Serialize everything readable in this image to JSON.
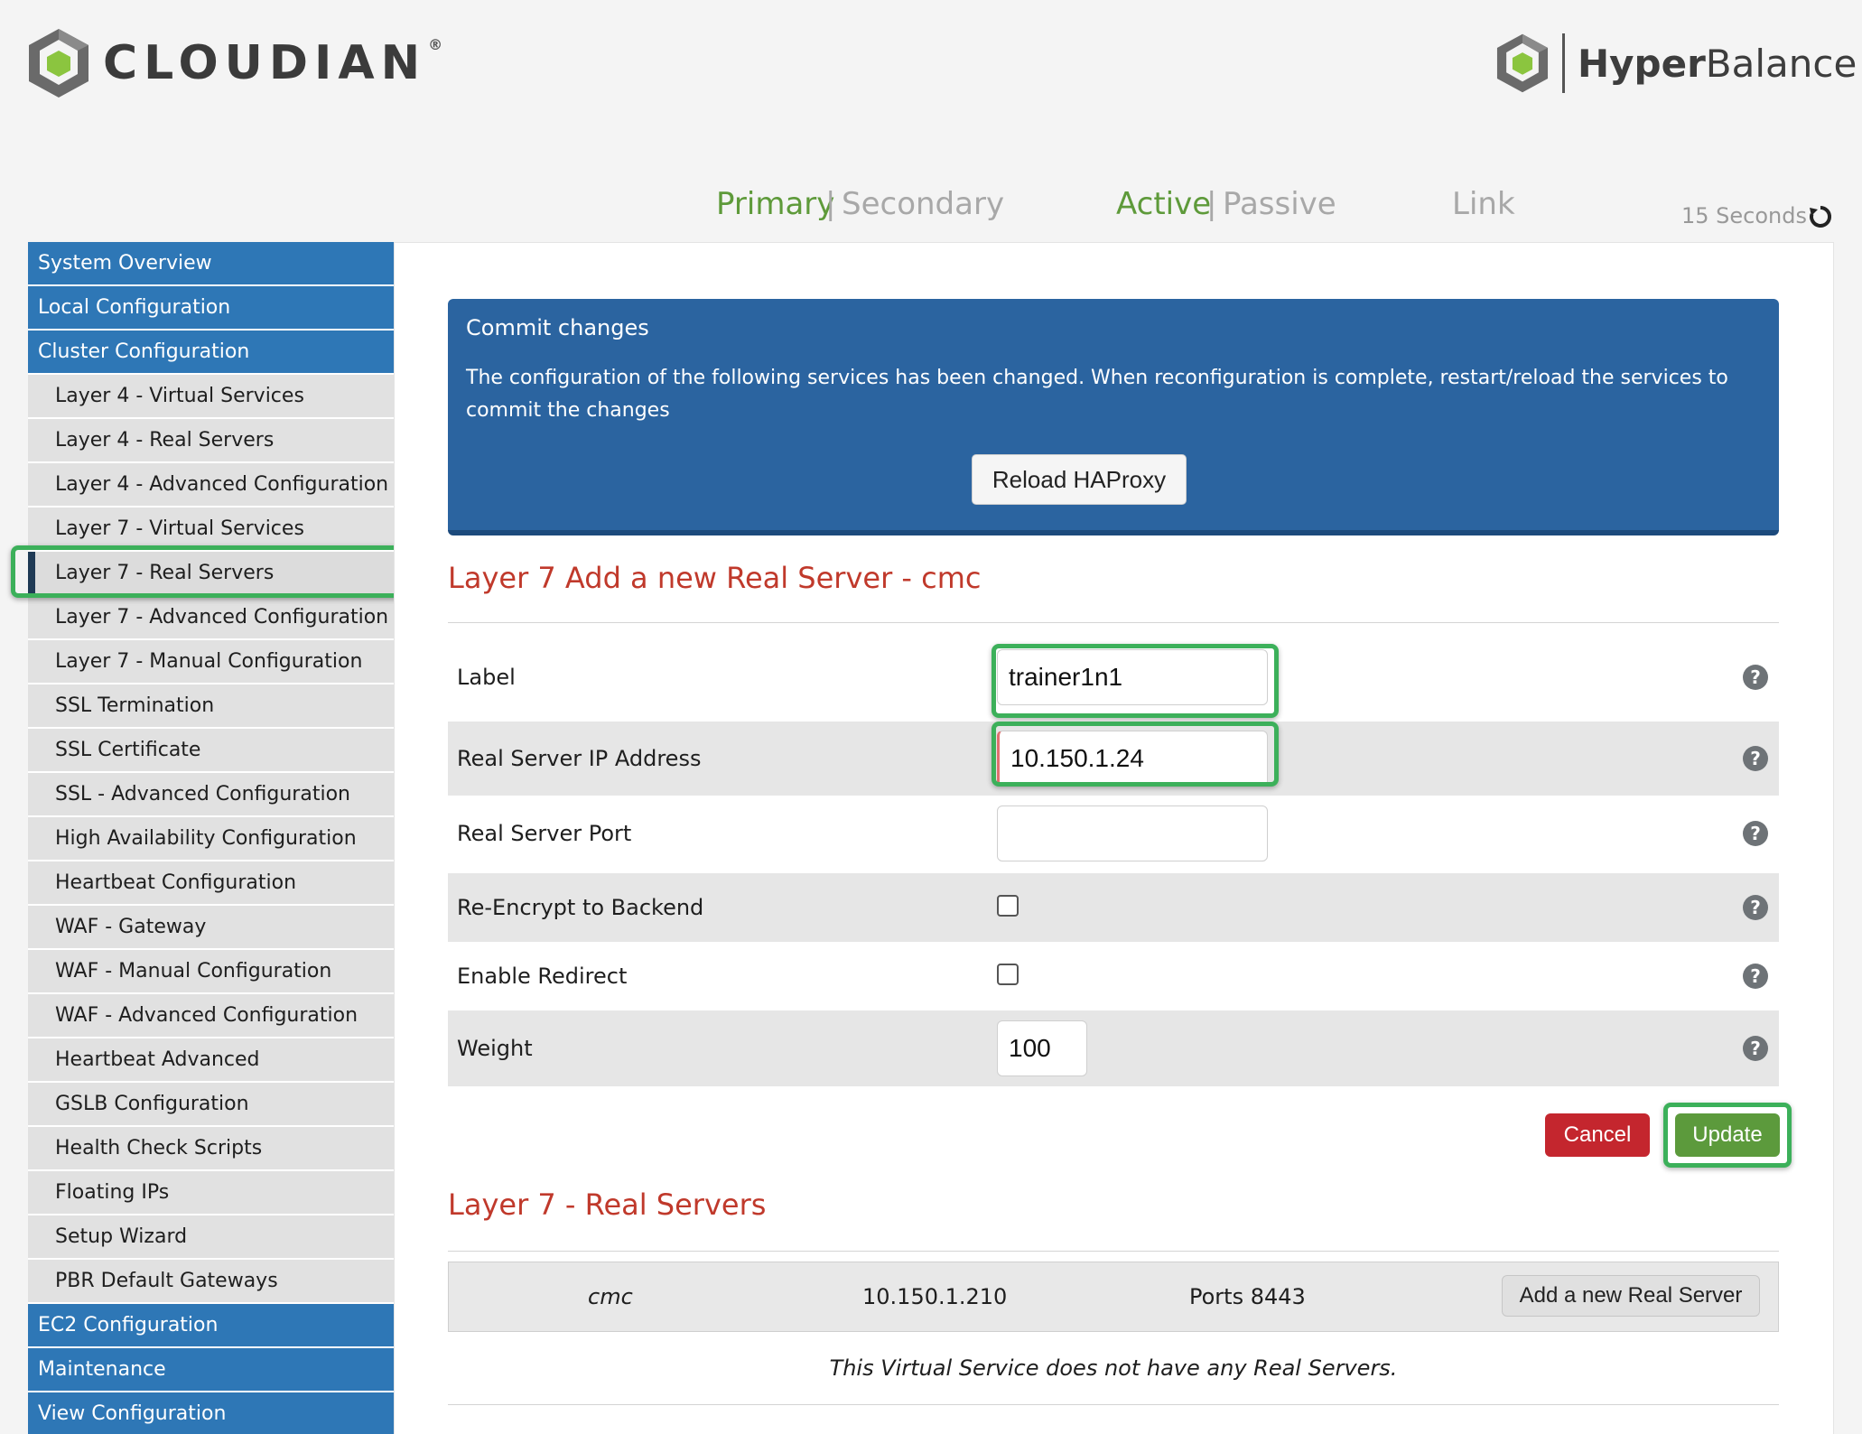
{
  "brand": {
    "company": "CLOUDIAN",
    "company_mark": "®",
    "product_bold": "Hyper",
    "product_rest": "Balance",
    "accent_green": "#8bc53f",
    "accent_grey": "#6a6a6a"
  },
  "status": {
    "primary": "Primary",
    "secondary": "Secondary",
    "active": "Active",
    "passive": "Passive",
    "link": "Link",
    "separator": "|",
    "refresh_interval": "15 Seconds",
    "refresh_icon": "refresh-icon"
  },
  "sidebar": {
    "items": [
      {
        "label": "System Overview",
        "level": "top"
      },
      {
        "label": "Local Configuration",
        "level": "top"
      },
      {
        "label": "Cluster Configuration",
        "level": "top"
      },
      {
        "label": "Layer 4 - Virtual Services",
        "level": "sub"
      },
      {
        "label": "Layer 4 - Real Servers",
        "level": "sub"
      },
      {
        "label": "Layer 4 - Advanced Configuration",
        "level": "sub"
      },
      {
        "label": "Layer 7 - Virtual Services",
        "level": "sub"
      },
      {
        "label": "Layer 7 - Real Servers",
        "level": "sub",
        "active": true
      },
      {
        "label": "Layer 7 - Advanced Configuration",
        "level": "sub"
      },
      {
        "label": "Layer 7 - Manual Configuration",
        "level": "sub"
      },
      {
        "label": "SSL Termination",
        "level": "sub"
      },
      {
        "label": "SSL Certificate",
        "level": "sub"
      },
      {
        "label": "SSL - Advanced Configuration",
        "level": "sub"
      },
      {
        "label": "High Availability Configuration",
        "level": "sub"
      },
      {
        "label": "Heartbeat Configuration",
        "level": "sub"
      },
      {
        "label": "WAF - Gateway",
        "level": "sub"
      },
      {
        "label": "WAF - Manual Configuration",
        "level": "sub"
      },
      {
        "label": "WAF - Advanced Configuration",
        "level": "sub"
      },
      {
        "label": "Heartbeat Advanced",
        "level": "sub"
      },
      {
        "label": "GSLB Configuration",
        "level": "sub"
      },
      {
        "label": "Health Check Scripts",
        "level": "sub"
      },
      {
        "label": "Floating IPs",
        "level": "sub"
      },
      {
        "label": "Setup Wizard",
        "level": "sub"
      },
      {
        "label": "PBR Default Gateways",
        "level": "sub"
      },
      {
        "label": "EC2 Configuration",
        "level": "top"
      },
      {
        "label": "Maintenance",
        "level": "top"
      },
      {
        "label": "View Configuration",
        "level": "top"
      }
    ]
  },
  "commit": {
    "title": "Commit changes",
    "message": "The configuration of the following services has been changed. When reconfiguration is complete, restart/reload the services to commit the changes",
    "button": "Reload HAProxy"
  },
  "form": {
    "title": "Layer 7 Add a new Real Server - cmc",
    "label_label": "Label",
    "label_value": "trainer1n1",
    "ip_label": "Real Server IP Address",
    "ip_value": "10.150.1.24",
    "port_label": "Real Server Port",
    "port_value": "",
    "reencrypt_label": "Re-Encrypt to Backend",
    "redirect_label": "Enable Redirect",
    "weight_label": "Weight",
    "weight_value": "100",
    "help_glyph": "?",
    "cancel": "Cancel",
    "update": "Update"
  },
  "real_servers": {
    "title": "Layer 7 - Real Servers",
    "vs_name": "cmc",
    "vs_ip": "10.150.1.210",
    "vs_ports": "Ports 8443",
    "add_button": "Add a new Real Server",
    "empty_message": "This Virtual Service does not have any Real Servers."
  }
}
